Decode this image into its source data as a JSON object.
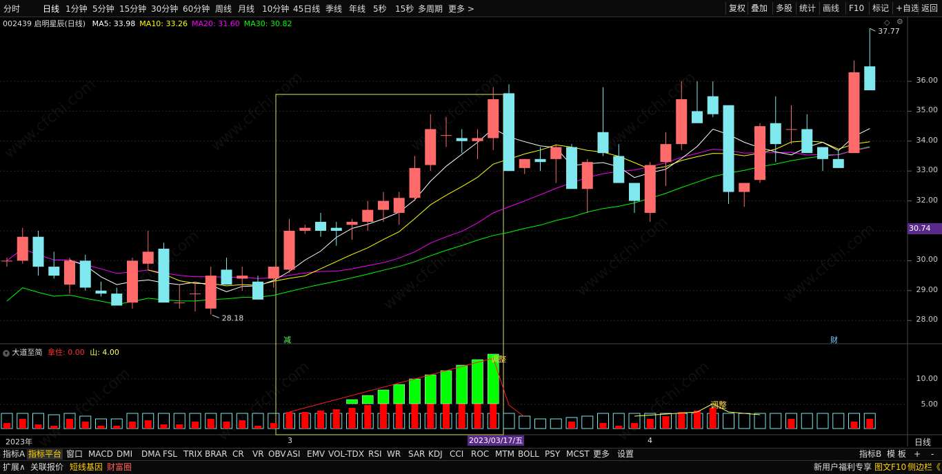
{
  "toolbar": {
    "periods": [
      "分时",
      "日线",
      "1分钟",
      "5分钟",
      "15分钟",
      "30分钟",
      "60分钟",
      "周线",
      "月线",
      "10分钟",
      "45日线",
      "季线",
      "年线",
      "5秒",
      "15秒",
      "多周期",
      "更多 >"
    ],
    "active_period": "日线",
    "right_buttons": [
      "复权",
      "叠加",
      "多股",
      "统计",
      "画线",
      "F10",
      "标记",
      "+自选",
      "返回"
    ]
  },
  "stock": {
    "title": "002439 启明星辰(日线)",
    "ma": [
      {
        "label": "MA5: 33.98",
        "color": "#ffffff"
      },
      {
        "label": "MA10: 33.26",
        "color": "#ffff00"
      },
      {
        "label": "MA20: 31.60",
        "color": "#ff00ff"
      },
      {
        "label": "MA30: 30.82",
        "color": "#00ff00"
      }
    ],
    "high_label": "37.77",
    "low_label": "28.18",
    "current_price": "30.74"
  },
  "price_axis": [
    "36.00",
    "35.00",
    "34.00",
    "33.00",
    "32.00",
    "31.00",
    "30.00",
    "29.00",
    "28.00"
  ],
  "markers": {
    "minus": "减",
    "finance": "财"
  },
  "indicator": {
    "name": "大道至简",
    "hold_label": "拿住: 0.00",
    "hill_label": "山: 4.00",
    "hold_color": "#ff3030",
    "hill_color": "#ffff60",
    "axis": [
      "10.00",
      "5.00"
    ],
    "annot1": "调整",
    "annot2": "调整"
  },
  "date_axis": {
    "year": "2023年",
    "m3": "3",
    "m4": "4",
    "cursor": "2023/03/17/五",
    "period": "日线"
  },
  "tabs": [
    "指标A",
    "指标平台",
    "窗口",
    "MACD",
    "DMI",
    "DMA",
    "FSL",
    "TRIX",
    "BRAR",
    "CR",
    "VR",
    "OBV",
    "ASI",
    "EMV",
    "VOL-TDX",
    "RSI",
    "WR",
    "SAR",
    "KDJ",
    "CCI",
    "ROC",
    "MTM",
    "BOLL",
    "PSY",
    "MCST",
    "更多",
    "设置"
  ],
  "active_tab": "指标平台",
  "tabs_right": [
    "指标B",
    "模 板",
    "+",
    "-"
  ],
  "status": {
    "expand": "扩展∧",
    "related": "关联报价",
    "short": "短线基因",
    "wealth": "财富圈",
    "promo": "新用户福利专享",
    "f10": "图文F10",
    "sidebar": "侧边栏《"
  },
  "watermark": "www.cfchi.com",
  "colors": {
    "up": "#ff6b6b",
    "down": "#7ee8ee",
    "vol_up": "#ff0000",
    "vol_bar": "#00ff00"
  },
  "chart_data": {
    "type": "candlestick",
    "candles": [
      [
        30.0,
        30.1,
        29.8,
        30.0
      ],
      [
        30.0,
        31.1,
        29.9,
        30.8
      ],
      [
        30.8,
        31.0,
        29.5,
        29.8
      ],
      [
        29.8,
        30.3,
        29.4,
        29.5
      ],
      [
        29.2,
        30.1,
        28.9,
        30.0
      ],
      [
        30.0,
        30.2,
        29.0,
        29.1
      ],
      [
        29.0,
        29.3,
        28.8,
        28.9
      ],
      [
        28.9,
        29.1,
        28.5,
        28.5
      ],
      [
        28.6,
        30.1,
        28.4,
        30.0
      ],
      [
        29.9,
        31.0,
        29.7,
        30.3
      ],
      [
        30.4,
        30.6,
        28.6,
        28.6
      ],
      [
        28.6,
        29.2,
        28.4,
        28.6
      ],
      [
        28.9,
        29.3,
        28.3,
        28.9
      ],
      [
        28.4,
        29.8,
        28.2,
        29.5
      ],
      [
        29.7,
        30.1,
        29.2,
        29.2
      ],
      [
        29.4,
        29.8,
        29.0,
        29.5
      ],
      [
        29.3,
        29.5,
        28.8,
        28.7
      ],
      [
        29.4,
        29.6,
        29.1,
        29.8
      ],
      [
        29.7,
        31.4,
        29.6,
        31.0
      ],
      [
        31.0,
        31.2,
        30.9,
        31.1
      ],
      [
        31.3,
        31.6,
        30.8,
        31.0
      ],
      [
        31.1,
        31.3,
        30.5,
        31.0
      ],
      [
        31.2,
        31.4,
        30.7,
        31.3
      ],
      [
        31.3,
        32.0,
        31.0,
        31.7
      ],
      [
        31.7,
        32.3,
        31.3,
        32.0
      ],
      [
        31.6,
        32.3,
        31.2,
        32.1
      ],
      [
        32.1,
        33.5,
        32.0,
        33.1
      ],
      [
        33.2,
        34.9,
        33.0,
        34.4
      ],
      [
        34.2,
        34.8,
        33.8,
        34.2
      ],
      [
        34.1,
        34.4,
        33.6,
        34.0
      ],
      [
        34.0,
        34.4,
        33.4,
        34.1
      ],
      [
        34.1,
        35.8,
        33.7,
        35.4
      ],
      [
        35.6,
        35.9,
        33.0,
        33.0
      ],
      [
        33.1,
        33.4,
        32.9,
        33.4
      ],
      [
        33.4,
        33.8,
        33.0,
        33.3
      ],
      [
        33.4,
        33.9,
        32.6,
        33.8
      ],
      [
        33.8,
        33.9,
        32.8,
        32.4
      ],
      [
        32.4,
        33.4,
        31.6,
        33.3
      ],
      [
        34.3,
        35.8,
        33.5,
        33.6
      ],
      [
        33.5,
        33.9,
        32.9,
        32.6
      ],
      [
        32.6,
        32.6,
        31.6,
        32.0
      ],
      [
        31.6,
        33.3,
        31.3,
        33.2
      ],
      [
        33.3,
        34.3,
        32.5,
        33.9
      ],
      [
        33.9,
        36.0,
        33.7,
        35.4
      ],
      [
        35.0,
        36.0,
        34.8,
        34.6
      ],
      [
        35.5,
        36.0,
        34.8,
        34.9
      ],
      [
        35.2,
        35.2,
        31.9,
        32.3
      ],
      [
        32.3,
        32.4,
        31.8,
        32.6
      ],
      [
        32.7,
        34.6,
        32.6,
        34.5
      ],
      [
        34.6,
        35.5,
        33.3,
        33.9
      ],
      [
        34.4,
        35.2,
        33.9,
        34.4
      ],
      [
        34.4,
        34.9,
        33.6,
        33.6
      ],
      [
        33.8,
        33.8,
        33.0,
        33.4
      ],
      [
        33.4,
        33.7,
        33.2,
        33.1
      ],
      [
        33.6,
        36.7,
        33.6,
        36.3
      ],
      [
        36.5,
        37.77,
        35.7,
        35.7
      ]
    ]
  }
}
